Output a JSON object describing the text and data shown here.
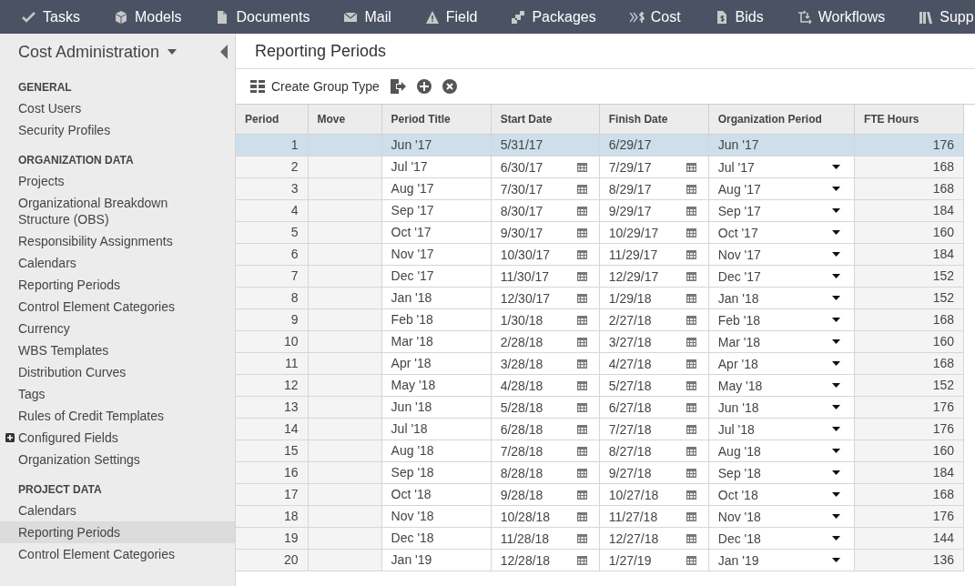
{
  "nav": [
    {
      "label": "Tasks"
    },
    {
      "label": "Models"
    },
    {
      "label": "Documents"
    },
    {
      "label": "Mail"
    },
    {
      "label": "Field"
    },
    {
      "label": "Packages"
    },
    {
      "label": "Cost"
    },
    {
      "label": "Bids"
    },
    {
      "label": "Workflows"
    },
    {
      "label": "Supp"
    }
  ],
  "sidebar": {
    "title": "Cost Administration",
    "sections": [
      {
        "heading": "GENERAL",
        "items": [
          {
            "label": "Cost Users",
            "selected": false
          },
          {
            "label": "Security Profiles",
            "selected": false
          }
        ]
      },
      {
        "heading": "ORGANIZATION DATA",
        "items": [
          {
            "label": "Projects",
            "selected": false
          },
          {
            "label": "Organizational Breakdown Structure (OBS)",
            "selected": false
          },
          {
            "label": "Responsibility Assignments",
            "selected": false
          },
          {
            "label": "Calendars",
            "selected": false
          },
          {
            "label": "Reporting Periods",
            "selected": false
          },
          {
            "label": "Control Element Categories",
            "selected": false
          },
          {
            "label": "Currency",
            "selected": false
          },
          {
            "label": "WBS Templates",
            "selected": false
          },
          {
            "label": "Distribution Curves",
            "selected": false
          },
          {
            "label": "Tags",
            "selected": false
          },
          {
            "label": "Rules of Credit Templates",
            "selected": false
          },
          {
            "label": "Configured Fields",
            "selected": false,
            "expanded": false
          },
          {
            "label": "Organization Settings",
            "selected": false
          }
        ]
      },
      {
        "heading": "PROJECT DATA",
        "items": [
          {
            "label": "Calendars",
            "selected": false
          },
          {
            "label": "Reporting Periods",
            "selected": true
          },
          {
            "label": "Control Element Categories",
            "selected": false
          }
        ]
      }
    ]
  },
  "page": {
    "title": "Reporting Periods"
  },
  "toolbar": {
    "label": "Create Group Type"
  },
  "table": {
    "columns": [
      "Period",
      "Move",
      "Period Title",
      "Start Date",
      "Finish Date",
      "Organization Period",
      "FTE Hours"
    ],
    "rows": [
      {
        "period": "1",
        "title": "Jun '17",
        "start": "5/31/17",
        "finish": "6/29/17",
        "org": "Jun '17",
        "fte": "176",
        "selected": true
      },
      {
        "period": "2",
        "title": "Jul '17",
        "start": "6/30/17",
        "finish": "7/29/17",
        "org": "Jul '17",
        "fte": "168",
        "selected": false
      },
      {
        "period": "3",
        "title": "Aug '17",
        "start": "7/30/17",
        "finish": "8/29/17",
        "org": "Aug '17",
        "fte": "168",
        "selected": false
      },
      {
        "period": "4",
        "title": "Sep '17",
        "start": "8/30/17",
        "finish": "9/29/17",
        "org": "Sep '17",
        "fte": "184",
        "selected": false
      },
      {
        "period": "5",
        "title": "Oct '17",
        "start": "9/30/17",
        "finish": "10/29/17",
        "org": "Oct '17",
        "fte": "160",
        "selected": false
      },
      {
        "period": "6",
        "title": "Nov '17",
        "start": "10/30/17",
        "finish": "11/29/17",
        "org": "Nov '17",
        "fte": "184",
        "selected": false
      },
      {
        "period": "7",
        "title": "Dec '17",
        "start": "11/30/17",
        "finish": "12/29/17",
        "org": "Dec '17",
        "fte": "152",
        "selected": false
      },
      {
        "period": "8",
        "title": "Jan '18",
        "start": "12/30/17",
        "finish": "1/29/18",
        "org": "Jan '18",
        "fte": "152",
        "selected": false
      },
      {
        "period": "9",
        "title": "Feb '18",
        "start": "1/30/18",
        "finish": "2/27/18",
        "org": "Feb '18",
        "fte": "168",
        "selected": false
      },
      {
        "period": "10",
        "title": "Mar '18",
        "start": "2/28/18",
        "finish": "3/27/18",
        "org": "Mar '18",
        "fte": "160",
        "selected": false
      },
      {
        "period": "11",
        "title": "Apr '18",
        "start": "3/28/18",
        "finish": "4/27/18",
        "org": "Apr '18",
        "fte": "168",
        "selected": false
      },
      {
        "period": "12",
        "title": "May '18",
        "start": "4/28/18",
        "finish": "5/27/18",
        "org": "May '18",
        "fte": "152",
        "selected": false
      },
      {
        "period": "13",
        "title": "Jun '18",
        "start": "5/28/18",
        "finish": "6/27/18",
        "org": "Jun '18",
        "fte": "176",
        "selected": false
      },
      {
        "period": "14",
        "title": "Jul '18",
        "start": "6/28/18",
        "finish": "7/27/18",
        "org": "Jul '18",
        "fte": "176",
        "selected": false
      },
      {
        "period": "15",
        "title": "Aug '18",
        "start": "7/28/18",
        "finish": "8/27/18",
        "org": "Aug '18",
        "fte": "160",
        "selected": false
      },
      {
        "period": "16",
        "title": "Sep '18",
        "start": "8/28/18",
        "finish": "9/27/18",
        "org": "Sep '18",
        "fte": "184",
        "selected": false
      },
      {
        "period": "17",
        "title": "Oct '18",
        "start": "9/28/18",
        "finish": "10/27/18",
        "org": "Oct '18",
        "fte": "168",
        "selected": false
      },
      {
        "period": "18",
        "title": "Nov '18",
        "start": "10/28/18",
        "finish": "11/27/18",
        "org": "Nov '18",
        "fte": "176",
        "selected": false
      },
      {
        "period": "19",
        "title": "Dec '18",
        "start": "11/28/18",
        "finish": "12/27/18",
        "org": "Dec '18",
        "fte": "144",
        "selected": false
      },
      {
        "period": "20",
        "title": "Jan '19",
        "start": "12/28/18",
        "finish": "1/27/19",
        "org": "Jan '19",
        "fte": "136",
        "selected": false
      }
    ]
  }
}
